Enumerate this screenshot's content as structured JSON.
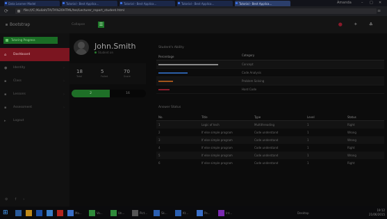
{
  "browser": {
    "tabs": [
      {
        "title": "Data Learner Model"
      },
      {
        "title": "Tutorial - Best Applica..."
      },
      {
        "title": "Tutorial - Best Applica..."
      },
      {
        "title": "Tutorial - Best Applica..."
      },
      {
        "title": "Tutorial - Best Applica..."
      }
    ],
    "profile": "Amanda",
    "url": "file:///C:/Kuliah/TA/TA%20HTML/tes/Lecturer_report_student.html"
  },
  "topbar": {
    "brand": "Bootstrap",
    "collapse_label": "Collapse",
    "button_glyph": "☰"
  },
  "sidebar": {
    "button_label": "Tutoring Progress",
    "items": [
      {
        "label": "Dashboard",
        "icon": "home-icon"
      },
      {
        "label": "Identity",
        "icon": "user-icon"
      },
      {
        "label": "Class",
        "icon": "class-icon"
      },
      {
        "label": "Lessons",
        "icon": "book-icon"
      },
      {
        "label": "Assessment",
        "icon": "chart-icon"
      },
      {
        "label": "Logout",
        "icon": "logout-icon"
      }
    ]
  },
  "profile": {
    "name": "John.Smith",
    "role": "Student on",
    "stats": [
      {
        "value": "18",
        "label": "Total"
      },
      {
        "value": "5",
        "label": "Failed"
      },
      {
        "value": "70",
        "label": "Score"
      }
    ],
    "split_left": "2",
    "split_right": "16"
  },
  "ability": {
    "title": "Student's Ability",
    "headers": [
      "Percentage",
      "Category"
    ],
    "rows": [
      {
        "category": "Concept",
        "percent": 82,
        "color": "#8a8a8a"
      },
      {
        "category": "Code Analysis",
        "percent": 40,
        "color": "#2b5ea8"
      },
      {
        "category": "Problem Solving",
        "percent": 20,
        "color": "#a1541b"
      },
      {
        "category": "Hard Code",
        "percent": 15,
        "color": "#8a1c2c"
      }
    ]
  },
  "answers": {
    "title": "Answer Status",
    "headers": [
      "No.",
      "Title",
      "Type",
      "Level",
      "Status"
    ],
    "rows": [
      {
        "no": "1",
        "title": "Logic of tech",
        "type": "Multithreading",
        "level": "1",
        "status": "Right"
      },
      {
        "no": "2",
        "title": "If else simple program",
        "type": "Code understand",
        "level": "1",
        "status": "Wrong"
      },
      {
        "no": "3",
        "title": "If else simple program",
        "type": "Code understand",
        "level": "1",
        "status": "Wrong"
      },
      {
        "no": "4",
        "title": "If else simple program",
        "type": "Code understand",
        "level": "1",
        "status": "Right"
      },
      {
        "no": "5",
        "title": "If else simple program",
        "type": "Code understand",
        "level": "1",
        "status": "Wrong"
      },
      {
        "no": "6",
        "title": "If else simple program",
        "type": "Code understand",
        "level": "1",
        "status": "Right"
      }
    ]
  },
  "taskbar": {
    "apps": [
      {
        "label": "",
        "color": "#2a5a9a"
      },
      {
        "label": "",
        "color": "#c08a1a"
      },
      {
        "label": "",
        "color": "#1b4fa3"
      },
      {
        "label": "",
        "color": "#3a7ec8"
      },
      {
        "label": "",
        "color": "#b3261e"
      },
      {
        "label": "Mo...",
        "color": "#3a6fc8"
      },
      {
        "label": "Vo...",
        "color": "#2f8a3a"
      },
      {
        "label": "Un...",
        "color": "#2f8a3a"
      },
      {
        "label": "Pict...",
        "color": "#555"
      },
      {
        "label": "Sk...",
        "color": "#2b5fb0"
      },
      {
        "label": "Kt...",
        "color": "#2b5fb0"
      },
      {
        "label": "Pe...",
        "color": "#3a6fc8"
      },
      {
        "label": "Int...",
        "color": "#7a2ab0"
      }
    ],
    "desktop_label": "Desktop",
    "time": "19:12",
    "date": "21/06/2015"
  }
}
